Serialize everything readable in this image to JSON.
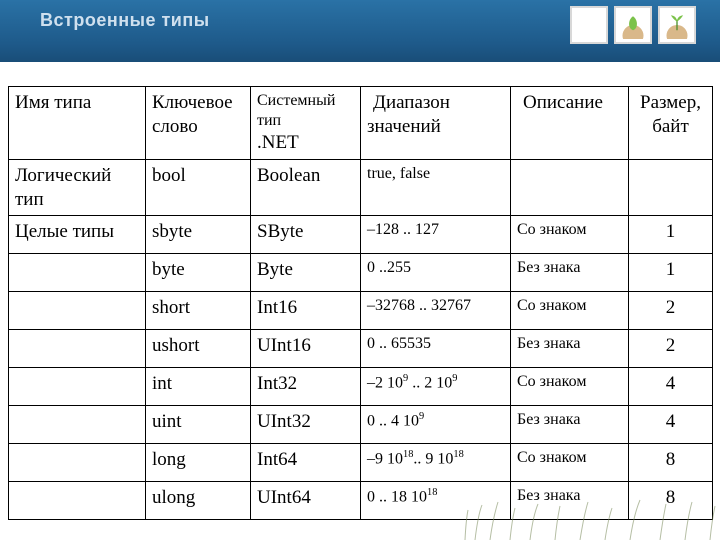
{
  "title": "Встроенные типы",
  "columns": {
    "name": "Имя типа",
    "keyword": "Ключевое слово",
    "net_l1": "Системный тип",
    "net_l2": ".NET",
    "range": "Диапазон значений",
    "desc": "Описание",
    "size": "Размер, байт"
  },
  "rows": [
    {
      "name": "Логический тип",
      "keyword": "bool",
      "net": "Boolean",
      "range": "true, false",
      "desc": "",
      "size": ""
    },
    {
      "name": "Целые типы",
      "keyword": "sbyte",
      "net": "SByte",
      "range": "–128 .. 127",
      "desc": "Со знаком",
      "size": "1"
    },
    {
      "name": "",
      "keyword": "byte",
      "net": "Byte",
      "range": "0 ..255",
      "desc": "Без знака",
      "size": "1"
    },
    {
      "name": "",
      "keyword": "short",
      "net": "Int16",
      "range": "–32768 .. 32767",
      "desc": "Со знаком",
      "size": "2"
    },
    {
      "name": "",
      "keyword": "ushort",
      "net": "UInt16",
      "range": "0 .. 65535",
      "desc": "Без знака",
      "size": "2"
    },
    {
      "name": "",
      "keyword": "int",
      "net": "Int32",
      "range": "–2·10^9 .. 2·10^9",
      "desc": "Со знаком",
      "size": "4"
    },
    {
      "name": "",
      "keyword": "uint",
      "net": "UInt32",
      "range": "0 .. 4·10^9",
      "desc": "Без знака",
      "size": "4"
    },
    {
      "name": "",
      "keyword": "long",
      "net": "Int64",
      "range": "–9·10^18.. 9·10^18",
      "desc": "Со знаком",
      "size": "8"
    },
    {
      "name": "",
      "keyword": "ulong",
      "net": "UInt64",
      "range": "0 .. 18·10^18",
      "desc": "Без знака",
      "size": "8"
    }
  ]
}
